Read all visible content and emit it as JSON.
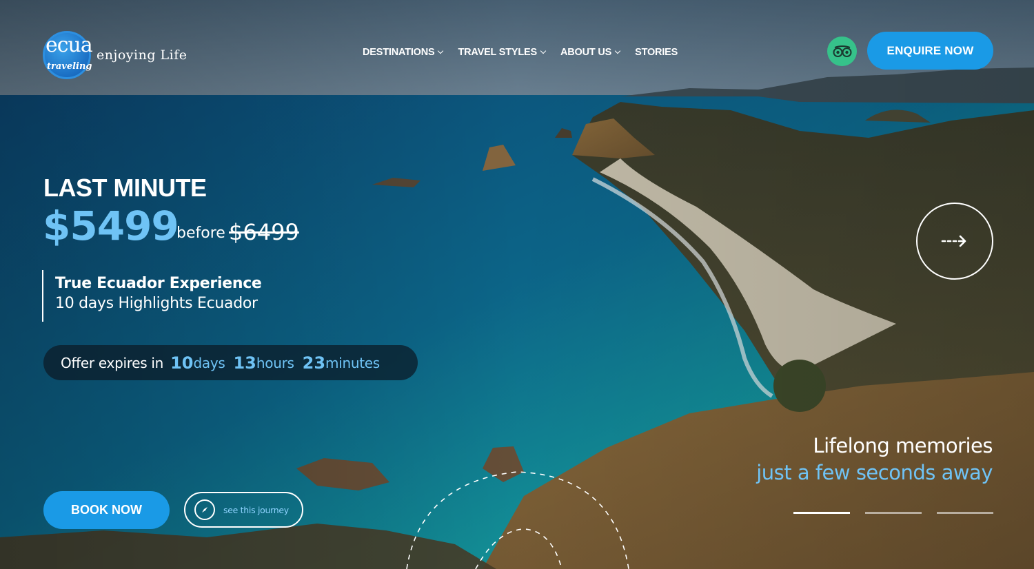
{
  "brand": {
    "logo_word": "ecua",
    "logo_script": "traveling",
    "tagline": "enjoying Life"
  },
  "nav": {
    "items": [
      {
        "label": "DESTINATIONS",
        "has_dropdown": true
      },
      {
        "label": "TRAVEL STYLES",
        "has_dropdown": true
      },
      {
        "label": "ABOUT US",
        "has_dropdown": true
      },
      {
        "label": "STORIES",
        "has_dropdown": false
      }
    ]
  },
  "header": {
    "tripadvisor_icon": "owl-eyes-icon",
    "enquire_label": "ENQUIRE NOW"
  },
  "promo": {
    "label": "LAST MINUTE",
    "price": "$5499",
    "before_label": "before",
    "old_price": "$6499",
    "trip_title": "True Ecuador Experience",
    "trip_subtitle": "10 days Highlights Ecuador",
    "countdown": {
      "label": "Offer expires in",
      "days": "10",
      "days_unit": "days",
      "hours": "13",
      "hours_unit": "hours",
      "minutes": "23",
      "minutes_unit": "minutes"
    },
    "book_label": "BOOK NOW",
    "journey_label": "see this journey"
  },
  "slider": {
    "tagline_line1": "Lifelong memories",
    "tagline_line2": "just a few seconds away",
    "slide_count": 3,
    "active_index": 0
  },
  "colors": {
    "accent": "#1a9ae6",
    "price_blue": "#6fc3f5",
    "tripadvisor_green": "#36c28a"
  }
}
